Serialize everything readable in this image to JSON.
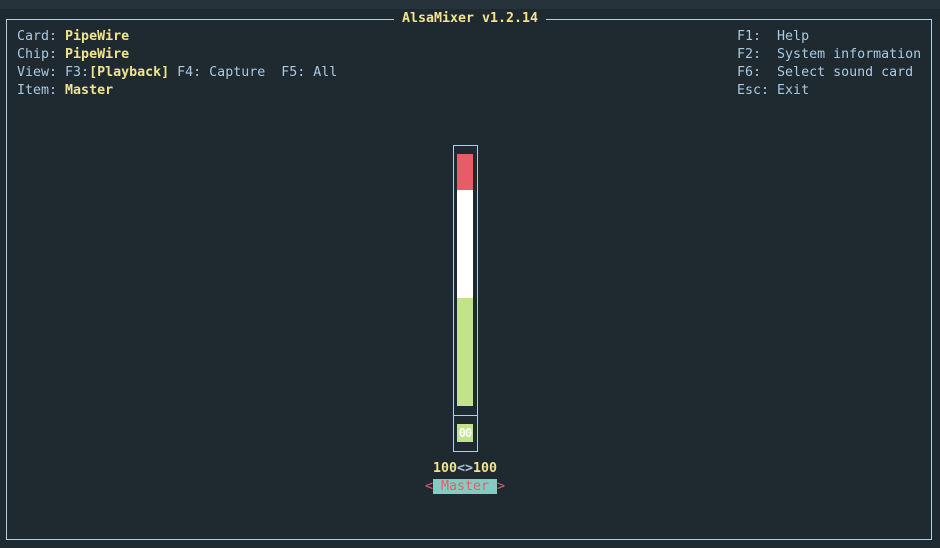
{
  "title": "AlsaMixer v1.2.14",
  "info": {
    "card_label": "Card:",
    "card": "PipeWire",
    "chip_label": "Chip:",
    "chip": "PipeWire",
    "view_label": "View:",
    "f3": "F3:",
    "playback": "[Playback]",
    "f4": "F4: Capture",
    "f5": "F5: All",
    "item_label": "Item:",
    "item": "Master"
  },
  "keys": [
    {
      "key": "F1:",
      "desc": "Help"
    },
    {
      "key": "F2:",
      "desc": "System information"
    },
    {
      "key": "F6:",
      "desc": "Select sound card"
    },
    {
      "key": "Esc:",
      "desc": "Exit"
    }
  ],
  "control": {
    "name": "Master",
    "left_arrow": "<",
    "right_arrow": ">",
    "left_level": "100",
    "sep": "<>",
    "right_level": "100",
    "value_box": "00",
    "volume_percent": 100
  },
  "colors": {
    "bg": "#1f2a30",
    "text": "#a9c9e3",
    "highlight": "#f2e38e",
    "red": "#e85c6a",
    "green": "#c3e38a",
    "teal": "#86cbc2"
  }
}
